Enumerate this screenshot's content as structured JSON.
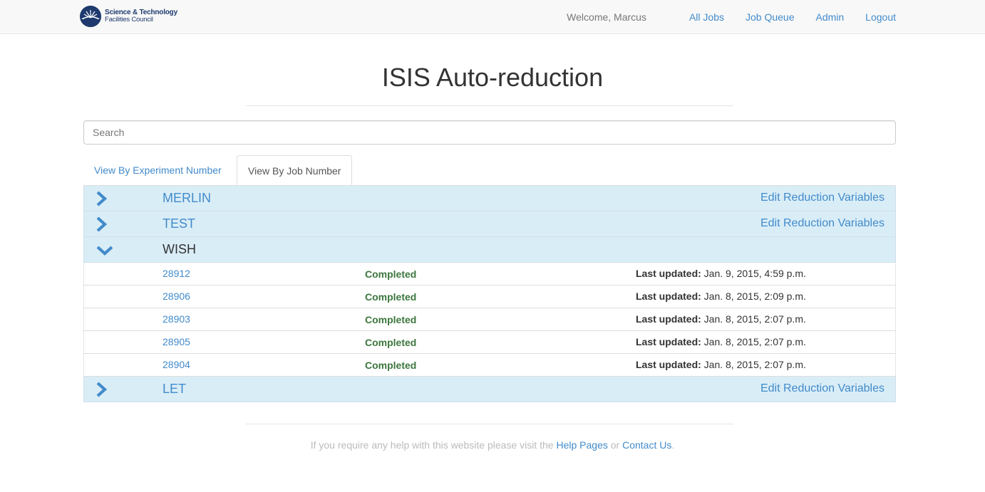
{
  "navbar": {
    "brand": {
      "line1": "Science & Technology",
      "line2": "Facilities Council"
    },
    "welcome": "Welcome, Marcus",
    "links": [
      "All Jobs",
      "Job Queue",
      "Admin",
      "Logout"
    ]
  },
  "page_title": "ISIS Auto-reduction",
  "search": {
    "placeholder": "Search",
    "value": ""
  },
  "tabs": [
    {
      "label": "View By Experiment Number",
      "active": false
    },
    {
      "label": "View By Job Number",
      "active": true
    }
  ],
  "instruments": [
    {
      "name": "MERLIN",
      "expanded": false,
      "edit_label": "Edit Reduction Variables"
    },
    {
      "name": "TEST",
      "expanded": false,
      "edit_label": "Edit Reduction Variables"
    },
    {
      "name": "WISH",
      "expanded": true,
      "edit_label": "",
      "runs": [
        {
          "run": "28912",
          "status": "Completed",
          "updated_label": "Last updated:",
          "updated": "Jan. 9, 2015, 4:59 p.m."
        },
        {
          "run": "28906",
          "status": "Completed",
          "updated_label": "Last updated:",
          "updated": "Jan. 8, 2015, 2:09 p.m."
        },
        {
          "run": "28903",
          "status": "Completed",
          "updated_label": "Last updated:",
          "updated": "Jan. 8, 2015, 2:07 p.m."
        },
        {
          "run": "28905",
          "status": "Completed",
          "updated_label": "Last updated:",
          "updated": "Jan. 8, 2015, 2:07 p.m."
        },
        {
          "run": "28904",
          "status": "Completed",
          "updated_label": "Last updated:",
          "updated": "Jan. 8, 2015, 2:07 p.m."
        }
      ]
    },
    {
      "name": "LET",
      "expanded": false,
      "edit_label": "Edit Reduction Variables"
    }
  ],
  "footer": {
    "text_before": "If you require any help with this website please visit the ",
    "help_link": "Help Pages",
    "text_middle": " or ",
    "contact_link": "Contact Us",
    "text_after": "."
  },
  "colors": {
    "accent": "#428bca",
    "row_highlight": "#d9edf7",
    "success": "#3c763d",
    "brand": "#1e3a6e"
  }
}
